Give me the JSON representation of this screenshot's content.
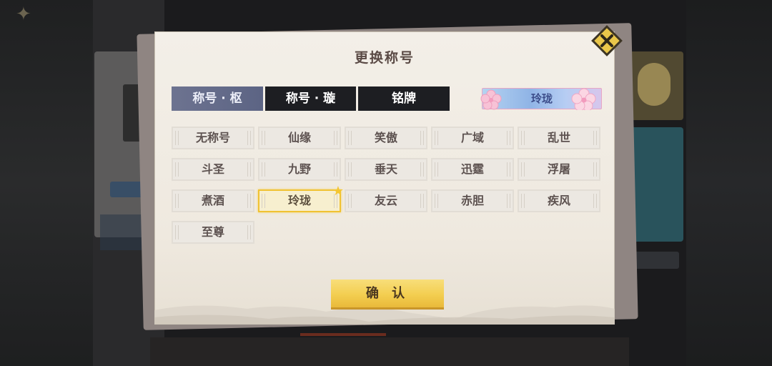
{
  "dialog": {
    "title": "更换称号",
    "close_icon": "close-x-icon"
  },
  "tabs": [
    {
      "label": "称号 · 枢",
      "active": true
    },
    {
      "label": "称号 · 璇",
      "active": false
    },
    {
      "label": "铭牌",
      "active": false
    }
  ],
  "preview": {
    "label": "玲珑",
    "icon": "cherry-blossom-icon"
  },
  "titles": [
    {
      "label": "无称号",
      "selected": false
    },
    {
      "label": "仙缘",
      "selected": false
    },
    {
      "label": "笑傲",
      "selected": false
    },
    {
      "label": "广域",
      "selected": false
    },
    {
      "label": "乱世",
      "selected": false
    },
    {
      "label": "斗圣",
      "selected": false
    },
    {
      "label": "九野",
      "selected": false
    },
    {
      "label": "垂天",
      "selected": false
    },
    {
      "label": "迅霆",
      "selected": false
    },
    {
      "label": "浮屠",
      "selected": false
    },
    {
      "label": "煮酒",
      "selected": false
    },
    {
      "label": "玲珑",
      "selected": true
    },
    {
      "label": "友云",
      "selected": false
    },
    {
      "label": "赤胆",
      "selected": false
    },
    {
      "label": "疾风",
      "selected": false
    },
    {
      "label": "至尊",
      "selected": false
    }
  ],
  "confirm_label": "确 认",
  "colors": {
    "accent_gold": "#f3ce50",
    "tab_dark": "#1d1e22",
    "tab_active": "#6d7390",
    "selected_border": "#f0c233"
  }
}
